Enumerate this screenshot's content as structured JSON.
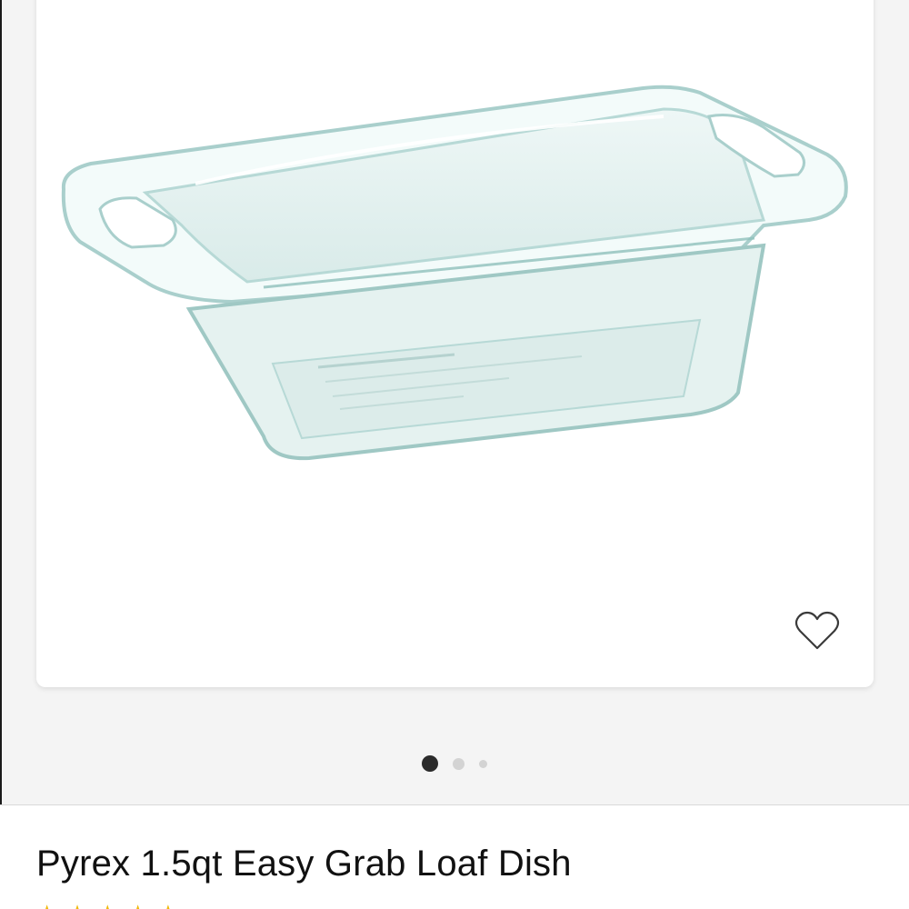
{
  "product": {
    "title": "Pyrex 1.5qt Easy Grab Loaf Dish",
    "image_alt": "glass loaf dish",
    "rating_stars": 5
  },
  "gallery": {
    "image_count": 3,
    "active_index": 0
  },
  "icons": {
    "favorite": "heart-outline-icon",
    "star": "star-icon"
  },
  "colors": {
    "background": "#f4f4f4",
    "card": "#ffffff",
    "active_dot": "#2b2b2b",
    "inactive_dot": "#d3d3d3",
    "star": "#f0b90b"
  }
}
